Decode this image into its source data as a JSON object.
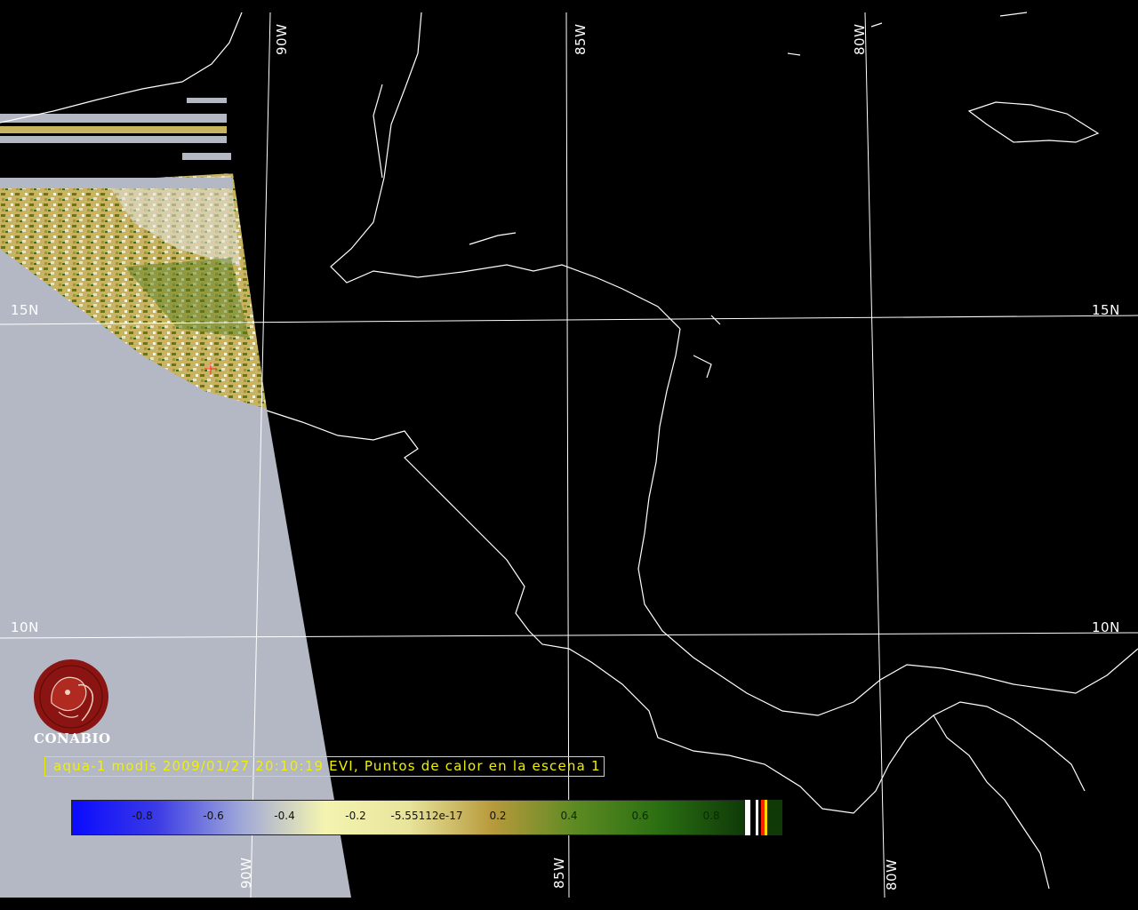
{
  "grid_labels": {
    "lon_top": [
      "90W",
      "85W",
      "80W"
    ],
    "lon_bottom": [
      "90W",
      "85W",
      "80W"
    ],
    "lat_left": [
      "15N",
      "10N"
    ],
    "lat_right": [
      "15N",
      "10N"
    ]
  },
  "logo": {
    "name": "CONABIO"
  },
  "caption": "aqua-1 modis 2009/01/27 20:10:19 EVI, Puntos de calor en la escena 1",
  "colorbar": {
    "tick_labels": [
      "-0.8",
      "-0.6",
      "-0.4",
      "-0.2",
      "-5.55112e-17",
      "0.2",
      "0.4",
      "0.6",
      "0.8"
    ],
    "colors": [
      "#0a0aff",
      "#3a3ae6",
      "#9ea6d8",
      "#f4f4b0",
      "#e8e49c",
      "#b89a3c",
      "#5c8a22",
      "#2a6e12",
      "#0f3a08"
    ],
    "end_swatches": [
      "#ffffff",
      "#000000",
      "#ffffff",
      "#000000",
      "#ff2000",
      "#ffd800",
      "#0f3a08"
    ]
  },
  "colors": {
    "background": "#000000",
    "no_data": "#b4b8c4",
    "coastline": "#ffffff",
    "grid": "#ffffff",
    "caption_text": "#f0f000",
    "logo": "#8a1412"
  },
  "hotspot_marker": {
    "color": "#ff2020"
  }
}
